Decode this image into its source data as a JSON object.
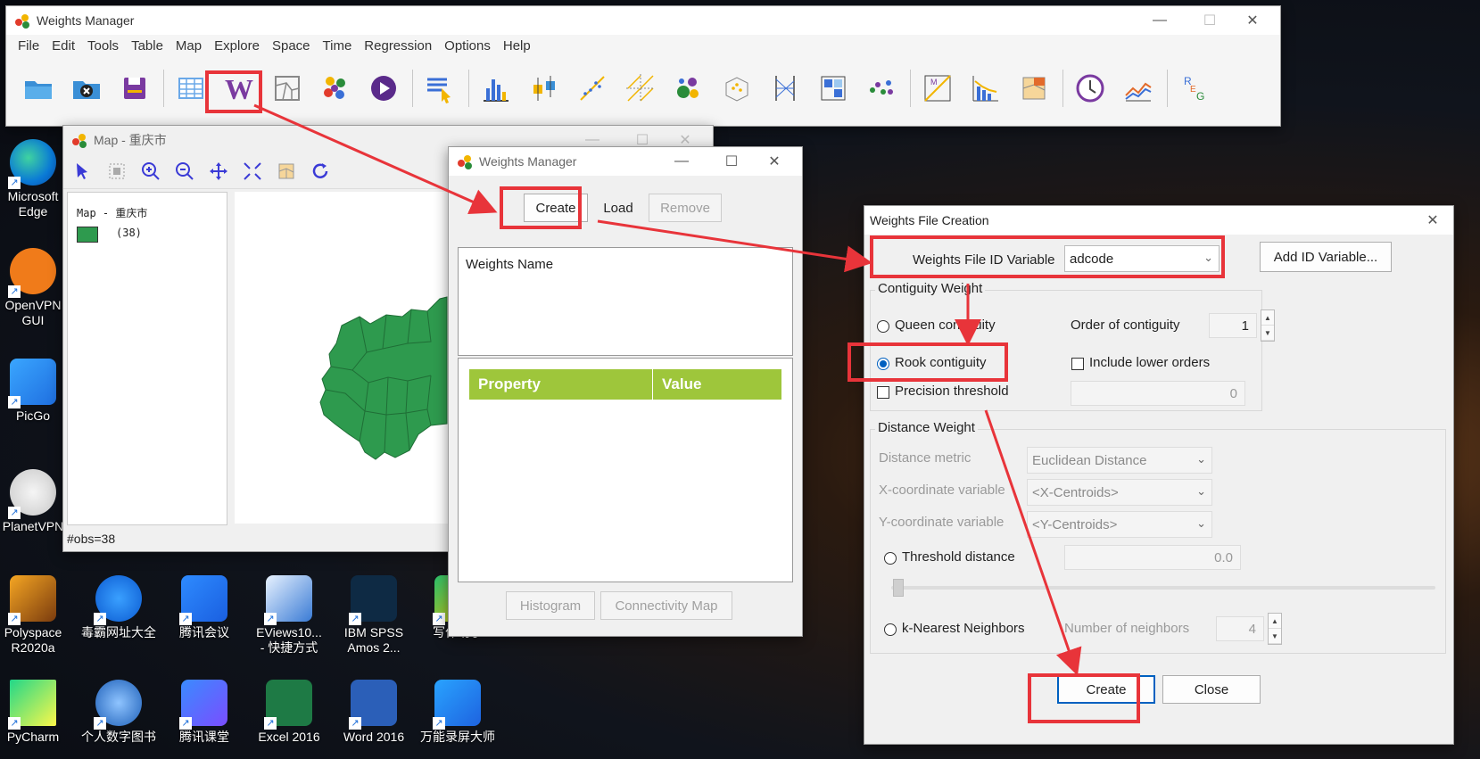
{
  "main_window": {
    "title": "Weights Manager",
    "menu": [
      "File",
      "Edit",
      "Tools",
      "Table",
      "Map",
      "Explore",
      "Space",
      "Time",
      "Regression",
      "Options",
      "Help"
    ]
  },
  "map_window": {
    "title": "Map - 重庆市",
    "legend_title": "Map - 重庆市",
    "legend_count": "(38)",
    "status": "#obs=38",
    "fill_color": "#2e9a4e"
  },
  "weights_manager": {
    "title": "Weights Manager",
    "create": "Create",
    "load": "Load",
    "remove": "Remove",
    "list_header": "Weights Name",
    "property": "Property",
    "value": "Value",
    "histogram": "Histogram",
    "connectivity_map": "Connectivity Map"
  },
  "wfc": {
    "title": "Weights File Creation",
    "id_label": "Weights File ID Variable",
    "id_value": "adcode",
    "add_id": "Add ID Variable...",
    "contiguity_group": "Contiguity Weight",
    "queen": "Queen contiguity",
    "rook": "Rook contiguity",
    "precision": "Precision threshold",
    "order_label": "Order of contiguity",
    "order_value": "1",
    "include_lower": "Include lower orders",
    "precision_value": "0",
    "distance_group": "Distance Weight",
    "metric_label": "Distance metric",
    "metric_value": "Euclidean Distance",
    "x_label": "X-coordinate variable",
    "x_value": "<X-Centroids>",
    "y_label": "Y-coordinate variable",
    "y_value": "<Y-Centroids>",
    "threshold": "Threshold distance",
    "threshold_value": "0.0",
    "knn": "k-Nearest Neighbors",
    "neighbors_label": "Number of neighbors",
    "neighbors_value": "4",
    "create": "Create",
    "close": "Close"
  },
  "desktop": {
    "icons": [
      {
        "label": "Microsoft\nEdge"
      },
      {
        "label": "OpenVPN\nGUI"
      },
      {
        "label": "PicGo"
      },
      {
        "label": "PlanetVPN"
      },
      {
        "label": "Polyspace\nR2020a"
      },
      {
        "label": "毒霸网址大全"
      },
      {
        "label": "腾讯会议"
      },
      {
        "label": "EViews10...\n- 快捷方式"
      },
      {
        "label": "IBM SPSS\nAmos 2..."
      },
      {
        "label": "写作助手"
      },
      {
        "label": "PyCharm"
      },
      {
        "label": "个人数字图书"
      },
      {
        "label": "腾讯课堂"
      },
      {
        "label": "Excel 2016"
      },
      {
        "label": "Word 2016"
      },
      {
        "label": "万能录屏大师"
      }
    ]
  },
  "accent": "#e8343a"
}
